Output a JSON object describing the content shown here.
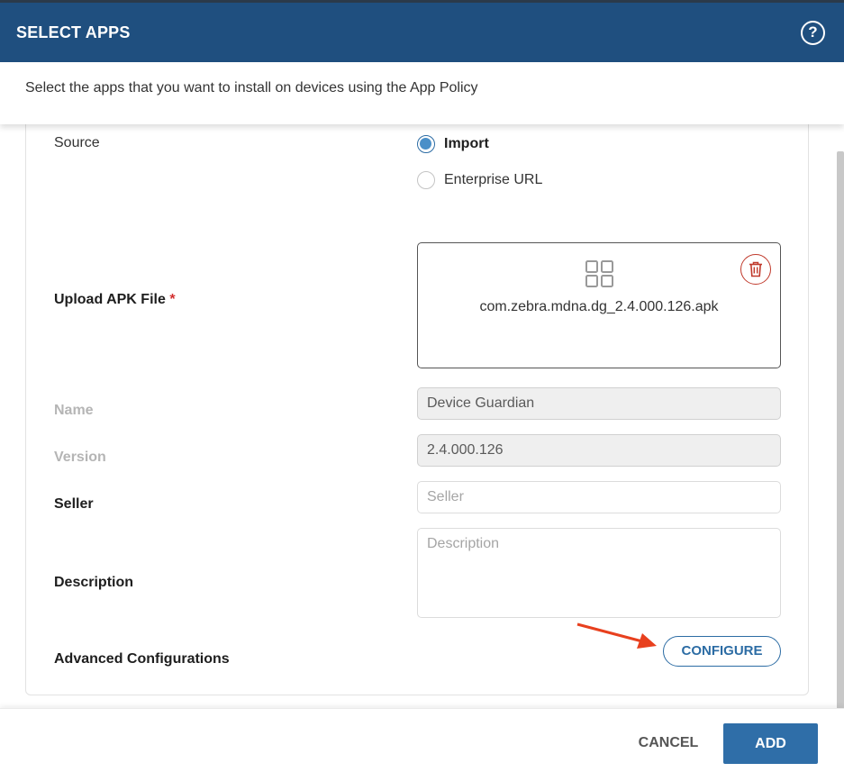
{
  "header": {
    "title": "SELECT APPS",
    "help_icon": "?"
  },
  "subheader": {
    "text": "Select the apps that you want to install on devices using the App Policy"
  },
  "form": {
    "source": {
      "label": "Source",
      "options": [
        {
          "label": "Import",
          "checked": true
        },
        {
          "label": "Enterprise URL",
          "checked": false
        }
      ]
    },
    "upload": {
      "label": "Upload APK File",
      "required_mark": "*",
      "file_name": "com.zebra.mdna.dg_2.4.000.126.apk",
      "icons": {
        "file": "apps-grid-icon",
        "delete": "trash-icon"
      }
    },
    "name": {
      "label": "Name",
      "value": "Device Guardian"
    },
    "version": {
      "label": "Version",
      "value": "2.4.000.126"
    },
    "seller": {
      "label": "Seller",
      "placeholder": "Seller"
    },
    "description": {
      "label": "Description",
      "placeholder": "Description"
    },
    "advanced": {
      "label": "Advanced Configurations",
      "button": "CONFIGURE"
    }
  },
  "footer": {
    "cancel": "CANCEL",
    "add": "ADD"
  },
  "colors": {
    "header_bg": "#1f4f7f",
    "accent": "#2c6ca4",
    "annotation_arrow": "#e8401e",
    "delete": "#c0392b"
  }
}
